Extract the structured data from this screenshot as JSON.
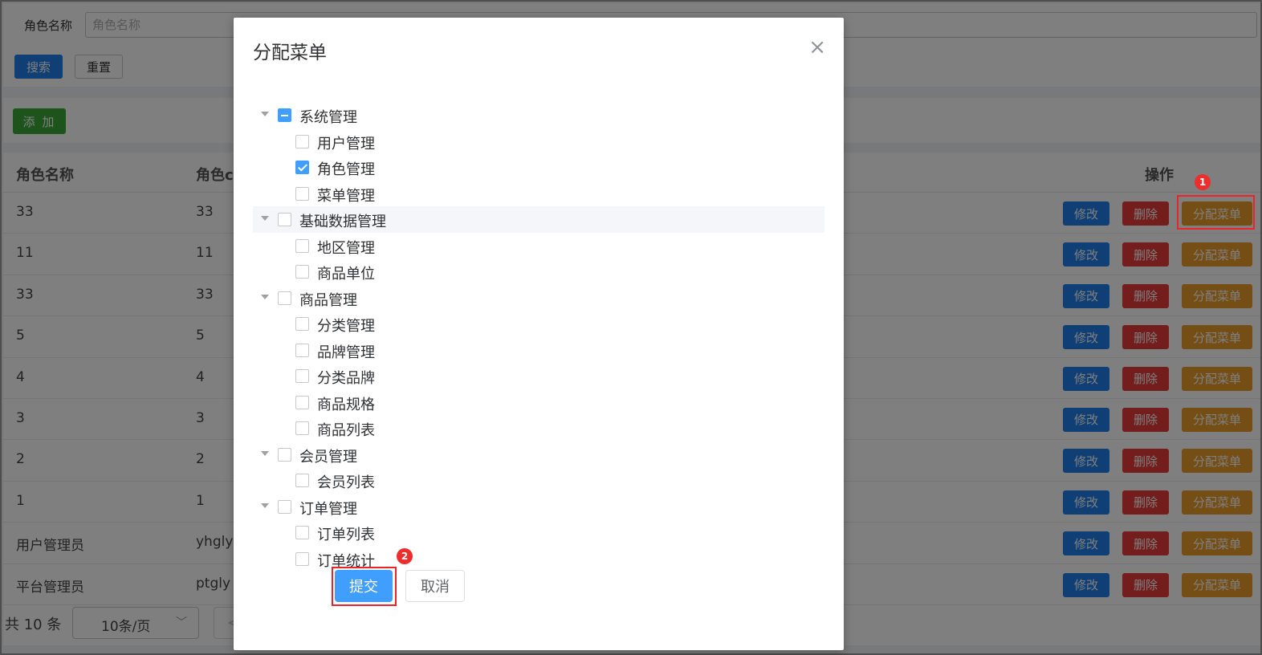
{
  "search": {
    "label": "角色名称",
    "placeholder": "角色名称",
    "search_button": "搜索",
    "reset_button": "重置"
  },
  "toolbar": {
    "add_button": "添 加"
  },
  "table": {
    "headers": {
      "name": "角色名称",
      "code": "角色co",
      "actions": "操作"
    },
    "rows": [
      {
        "name": "33",
        "code": "33"
      },
      {
        "name": "11",
        "code": "11"
      },
      {
        "name": "33",
        "code": "33"
      },
      {
        "name": "5",
        "code": "5"
      },
      {
        "name": "4",
        "code": "4"
      },
      {
        "name": "3",
        "code": "3"
      },
      {
        "name": "2",
        "code": "2"
      },
      {
        "name": "1",
        "code": "1"
      },
      {
        "name": "用户管理员",
        "code": "yhgly"
      },
      {
        "name": "平台管理员",
        "code": "ptgly"
      }
    ],
    "action_labels": {
      "edit": "修改",
      "delete": "删除",
      "assign": "分配菜单"
    }
  },
  "pagination": {
    "total": "共 10 条",
    "page_size": "10条/页",
    "prev": "<"
  },
  "annotations": {
    "badge_1": "1",
    "badge_2": "2",
    "highlight_color": "#e8262a"
  },
  "dialog": {
    "title": "分配菜单",
    "close": "×",
    "tree": [
      {
        "label": "系统管理",
        "level": 1,
        "expandable": true,
        "state": "indeterminate"
      },
      {
        "label": "用户管理",
        "level": 2,
        "state": "unchecked"
      },
      {
        "label": "角色管理",
        "level": 2,
        "state": "checked"
      },
      {
        "label": "菜单管理",
        "level": 2,
        "state": "unchecked"
      },
      {
        "label": "基础数据管理",
        "level": 1,
        "expandable": true,
        "state": "unchecked",
        "hovered": true
      },
      {
        "label": "地区管理",
        "level": 2,
        "state": "unchecked"
      },
      {
        "label": "商品单位",
        "level": 2,
        "state": "unchecked"
      },
      {
        "label": "商品管理",
        "level": 1,
        "expandable": true,
        "state": "unchecked"
      },
      {
        "label": "分类管理",
        "level": 2,
        "state": "unchecked"
      },
      {
        "label": "品牌管理",
        "level": 2,
        "state": "unchecked"
      },
      {
        "label": "分类品牌",
        "level": 2,
        "state": "unchecked"
      },
      {
        "label": "商品规格",
        "level": 2,
        "state": "unchecked"
      },
      {
        "label": "商品列表",
        "level": 2,
        "state": "unchecked"
      },
      {
        "label": "会员管理",
        "level": 1,
        "expandable": true,
        "state": "unchecked"
      },
      {
        "label": "会员列表",
        "level": 2,
        "state": "unchecked"
      },
      {
        "label": "订单管理",
        "level": 1,
        "expandable": true,
        "state": "unchecked"
      },
      {
        "label": "订单列表",
        "level": 2,
        "state": "unchecked"
      },
      {
        "label": "订单统计",
        "level": 2,
        "state": "unchecked"
      }
    ],
    "submit_button": "提交",
    "cancel_button": "取消"
  },
  "colors": {
    "primary": "#409eff",
    "edit": "#1e7ee8",
    "delete": "#e63b3b",
    "assign": "#e89c2a",
    "add": "#3aa838"
  }
}
